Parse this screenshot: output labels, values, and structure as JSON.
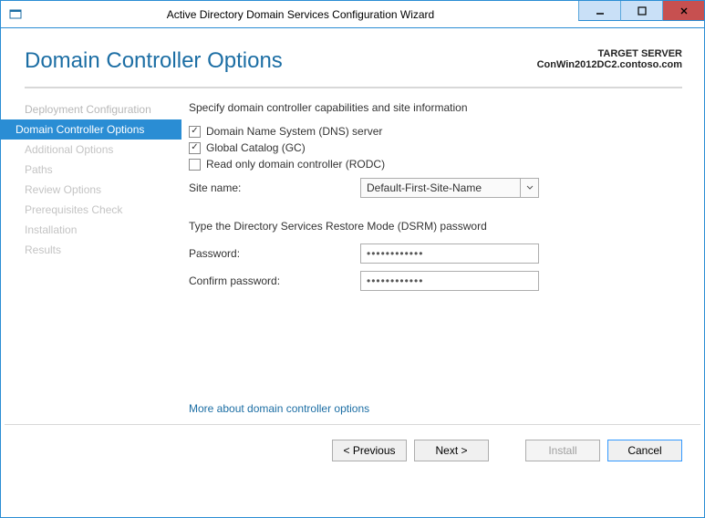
{
  "window": {
    "title": "Active Directory Domain Services Configuration Wizard"
  },
  "header": {
    "page_title": "Domain Controller Options",
    "target_label": "TARGET SERVER",
    "target_server": "ConWin2012DC2.contoso.com"
  },
  "nav": {
    "items": [
      {
        "label": "Deployment Configuration"
      },
      {
        "label": "Domain Controller Options"
      },
      {
        "label": "Additional Options"
      },
      {
        "label": "Paths"
      },
      {
        "label": "Review Options"
      },
      {
        "label": "Prerequisites Check"
      },
      {
        "label": "Installation"
      },
      {
        "label": "Results"
      }
    ]
  },
  "content": {
    "section1_heading": "Specify domain controller capabilities and site information",
    "dns_label": "Domain Name System (DNS) server",
    "dns_checked": true,
    "gc_label": "Global Catalog (GC)",
    "gc_checked": true,
    "rodc_label": "Read only domain controller (RODC)",
    "rodc_checked": false,
    "site_name_label": "Site name:",
    "site_name_value": "Default-First-Site-Name",
    "section2_heading": "Type the Directory Services Restore Mode (DSRM) password",
    "password_label": "Password:",
    "password_value": "••••••••••••",
    "confirm_label": "Confirm password:",
    "confirm_value": "••••••••••••",
    "help_link": "More about domain controller options"
  },
  "footer": {
    "previous": "< Previous",
    "next": "Next >",
    "install": "Install",
    "cancel": "Cancel"
  }
}
